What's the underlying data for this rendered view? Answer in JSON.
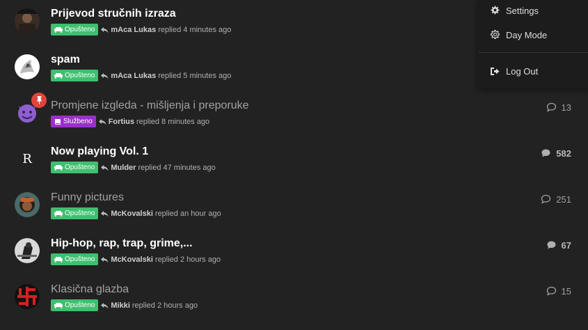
{
  "colors": {
    "tag_general": "#3fbf6f",
    "tag_official": "#9b30c9",
    "pin": "#e0443d"
  },
  "topics": [
    {
      "title": "Prijevod stručnih izraza",
      "tag": "Opušteno",
      "tag_icon": "couch-icon",
      "author": "mAca Lukas",
      "replied_text": "replied 4 minutes ago",
      "count": "",
      "unread": true
    },
    {
      "title": "spam",
      "tag": "Opušteno",
      "tag_icon": "couch-icon",
      "author": "mAca Lukas",
      "replied_text": "replied 5 minutes ago",
      "count": "",
      "unread": true
    },
    {
      "title": "Promjene izgleda - mišljenja i preporuke",
      "tag": "Službeno",
      "tag_icon": "book-icon",
      "author": "Fortius",
      "replied_text": "replied 8 minutes ago",
      "count": "13",
      "unread": false,
      "pinned": true
    },
    {
      "title": "Now playing Vol. 1",
      "tag": "Opušteno",
      "tag_icon": "couch-icon",
      "author": "Mulder",
      "replied_text": "replied 47 minutes ago",
      "count": "582",
      "unread": true,
      "avatar_letter": "R"
    },
    {
      "title": "Funny pictures",
      "tag": "Opušteno",
      "tag_icon": "couch-icon",
      "author": "McKovalski",
      "replied_text": "replied an hour ago",
      "count": "251",
      "unread": false
    },
    {
      "title": "Hip-hop, rap, trap, grime,...",
      "tag": "Opušteno",
      "tag_icon": "couch-icon",
      "author": "McKovalski",
      "replied_text": "replied 2 hours ago",
      "count": "67",
      "unread": true
    },
    {
      "title": "Klasična glazba",
      "tag": "Opušteno",
      "tag_icon": "couch-icon",
      "author": "Mikki",
      "replied_text": "replied 2 hours ago",
      "count": "15",
      "unread": false
    }
  ],
  "menu": {
    "settings": "Settings",
    "day_mode": "Day Mode",
    "log_out": "Log Out"
  }
}
